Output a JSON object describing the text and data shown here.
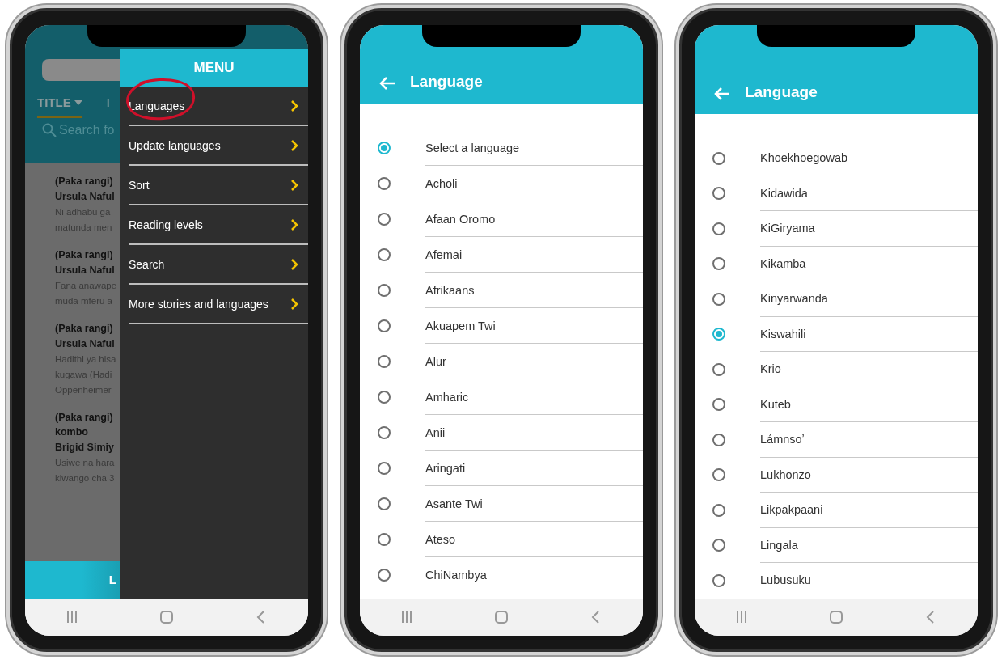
{
  "phones": [
    {
      "kind": "menu",
      "app": {
        "tabs": [
          {
            "label": "TITLE",
            "selected": true
          },
          {
            "label": "I",
            "selected": false
          }
        ],
        "search_placeholder": "Search fo",
        "stories": [
          {
            "title_lines": [
              "(Paka rangi)"
            ],
            "author": "Ursula Naful",
            "summary_lines": [
              "Ni adhabu ga",
              "matunda men"
            ]
          },
          {
            "title_lines": [
              "(Paka rangi)"
            ],
            "author": "Ursula Naful",
            "summary_lines": [
              "Fana anawape",
              "muda mferu a"
            ]
          },
          {
            "title_lines": [
              "(Paka rangi)"
            ],
            "author": "Ursula Naful",
            "summary_lines": [
              "Hadithi ya hisa",
              "kugawa (Hadi",
              "Oppenheimer"
            ]
          },
          {
            "title_lines": [
              "(Paka rangi)",
              "kombo"
            ],
            "author": "Brigid Simiy",
            "summary_lines": [
              "Usiwe na hara",
              "kiwango cha 3"
            ]
          }
        ],
        "bottom_button": "L"
      },
      "menu": {
        "title": "MENU",
        "items": [
          {
            "label": "Languages",
            "circled": true
          },
          {
            "label": "Update languages",
            "circled": false
          },
          {
            "label": "Sort",
            "circled": false
          },
          {
            "label": "Reading levels",
            "circled": false
          },
          {
            "label": "Search",
            "circled": false
          },
          {
            "label": "More stories and languages",
            "circled": false
          }
        ]
      }
    },
    {
      "kind": "language",
      "title": "Language",
      "options": [
        {
          "label": "Select a language",
          "selected": true
        },
        {
          "label": "Acholi",
          "selected": false
        },
        {
          "label": "Afaan Oromo",
          "selected": false
        },
        {
          "label": "Afemai",
          "selected": false
        },
        {
          "label": "Afrikaans",
          "selected": false
        },
        {
          "label": "Akuapem Twi",
          "selected": false
        },
        {
          "label": "Alur",
          "selected": false
        },
        {
          "label": "Amharic",
          "selected": false
        },
        {
          "label": "Anii",
          "selected": false
        },
        {
          "label": "Aringati",
          "selected": false
        },
        {
          "label": "Asante Twi",
          "selected": false
        },
        {
          "label": "Ateso",
          "selected": false
        },
        {
          "label": "ChiNambya",
          "selected": false
        }
      ]
    },
    {
      "kind": "language",
      "title": "Language",
      "options": [
        {
          "label": "Khoekhoegowab",
          "selected": false
        },
        {
          "label": "Kidawida",
          "selected": false
        },
        {
          "label": "KiGiryama",
          "selected": false
        },
        {
          "label": "Kikamba",
          "selected": false
        },
        {
          "label": "Kinyarwanda",
          "selected": false
        },
        {
          "label": "Kiswahili",
          "selected": true
        },
        {
          "label": "Krio",
          "selected": false
        },
        {
          "label": "Kuteb",
          "selected": false
        },
        {
          "label": "Lámnsoʼ",
          "selected": false
        },
        {
          "label": "Lukhonzo",
          "selected": false
        },
        {
          "label": "Likpakpaani",
          "selected": false
        },
        {
          "label": "Lingala",
          "selected": false
        },
        {
          "label": "Lubusuku",
          "selected": false
        }
      ]
    }
  ]
}
